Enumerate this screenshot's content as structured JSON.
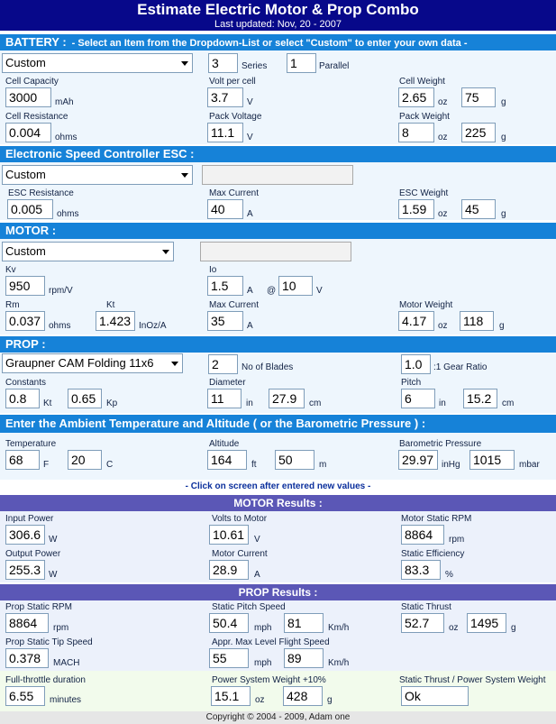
{
  "header": {
    "title": "Estimate Electric Motor & Prop Combo",
    "updated": "Last updated: Nov, 20 - 2007"
  },
  "battery": {
    "section_title": "BATTERY :",
    "note": "- Select an Item from the Dropdown-List or select \"Custom\" to enter your own data -",
    "type": "Custom",
    "series": "3",
    "series_label": "Series",
    "parallel": "1",
    "parallel_label": "Parallel",
    "cell_capacity_label": "Cell Capacity",
    "cell_capacity": "3000",
    "cell_capacity_unit": "mAh",
    "volt_per_cell_label": "Volt per cell",
    "volt_per_cell": "3.7",
    "volt_per_cell_unit": "V",
    "cell_weight_label": "Cell Weight",
    "cell_weight_oz": "2.65",
    "cell_weight_g": "75",
    "cell_resistance_label": "Cell Resistance",
    "cell_resistance": "0.004",
    "cell_resistance_unit": "ohms",
    "pack_voltage_label": "Pack Voltage",
    "pack_voltage": "11.1",
    "pack_voltage_unit": "V",
    "pack_weight_label": "Pack Weight",
    "pack_weight_oz": "8",
    "pack_weight_g": "225",
    "oz": "oz",
    "g": "g"
  },
  "esc": {
    "section_title": "Electronic Speed Controller ESC :",
    "type": "Custom",
    "resistance_label": "ESC Resistance",
    "resistance": "0.005",
    "resistance_unit": "ohms",
    "max_current_label": "Max Current",
    "max_current": "40",
    "max_current_unit": "A",
    "weight_label": "ESC Weight",
    "weight_oz": "1.59",
    "weight_g": "45"
  },
  "motor": {
    "section_title": "MOTOR :",
    "type": "Custom",
    "kv_label": "Kv",
    "kv": "950",
    "kv_unit": "rpm/V",
    "io_label": "Io",
    "io": "1.5",
    "io_unit": "A",
    "io_at": "@",
    "io_volt": "10",
    "io_volt_unit": "V",
    "rm_label": "Rm",
    "rm": "0.037",
    "rm_unit": "ohms",
    "kt_label": "Kt",
    "kt": "1.423",
    "kt_unit": "InOz/A",
    "max_current_label": "Max Current",
    "max_current": "35",
    "max_current_unit": "A",
    "weight_label": "Motor Weight",
    "weight_oz": "4.17",
    "weight_g": "118"
  },
  "prop": {
    "section_title": "PROP :",
    "type": "Graupner CAM Folding 11x6",
    "blades": "2",
    "blades_label": "No of Blades",
    "gear": "1.0",
    "gear_label": ":1 Gear Ratio",
    "constants_label": "Constants",
    "kt": "0.8",
    "kt_unit": "Kt",
    "kp": "0.65",
    "kp_unit": "Kp",
    "diameter_label": "Diameter",
    "diameter_in": "11",
    "diameter_cm": "27.9",
    "pitch_label": "Pitch",
    "pitch_in": "6",
    "pitch_cm": "15.2",
    "in": "in",
    "cm": "cm"
  },
  "ambient": {
    "section_title": "Enter the Ambient Temperature and Altitude   ( or the Barometric Pressure ) :",
    "temp_label": "Temperature",
    "temp_f": "68",
    "temp_f_unit": "F",
    "temp_c": "20",
    "temp_c_unit": "C",
    "alt_label": "Altitude",
    "alt_ft": "164",
    "alt_ft_unit": "ft",
    "alt_m": "50",
    "alt_m_unit": "m",
    "baro_label": "Barometric Pressure",
    "baro_inhg": "29.97",
    "baro_inhg_unit": "inHg",
    "baro_mbar": "1015",
    "baro_mbar_unit": "mbar"
  },
  "click_note": "- Click on screen after entered new values -",
  "motor_results": {
    "title": "MOTOR Results :",
    "input_power_label": "Input Power",
    "input_power": "306.6",
    "input_power_unit": "W",
    "volts_label": "Volts to Motor",
    "volts": "10.61",
    "volts_unit": "V",
    "rpm_label": "Motor Static RPM",
    "rpm": "8864",
    "rpm_unit": "rpm",
    "output_power_label": "Output Power",
    "output_power": "255.3",
    "output_power_unit": "W",
    "current_label": "Motor Current",
    "current": "28.9",
    "current_unit": "A",
    "eff_label": "Static Efficiency",
    "eff": "83.3",
    "eff_unit": "%"
  },
  "prop_results": {
    "title": "PROP Results :",
    "rpm_label": "Prop Static RPM",
    "rpm": "8864",
    "rpm_unit": "rpm",
    "pitch_speed_label": "Static Pitch Speed",
    "pitch_speed_mph": "50.4",
    "pitch_speed_kmh": "81",
    "thrust_label": "Static Thrust",
    "thrust_oz": "52.7",
    "thrust_g": "1495",
    "tip_label": "Prop Static Tip Speed",
    "tip": "0.378",
    "tip_unit": "MACH",
    "flight_label": "Appr. Max Level Flight Speed",
    "flight_mph": "55",
    "flight_kmh": "89",
    "mph": "mph",
    "kmh": "Km/h"
  },
  "summary": {
    "duration_label": "Full-throttle duration",
    "duration": "6.55",
    "duration_unit": "minutes",
    "weight_label": "Power System Weight +10%",
    "weight_oz": "15.1",
    "weight_g": "428",
    "ratio_label": "Static Thrust / Power System Weight",
    "ratio": "Ok"
  },
  "footer": "Copyright © 2004 - 2009, Adam one"
}
